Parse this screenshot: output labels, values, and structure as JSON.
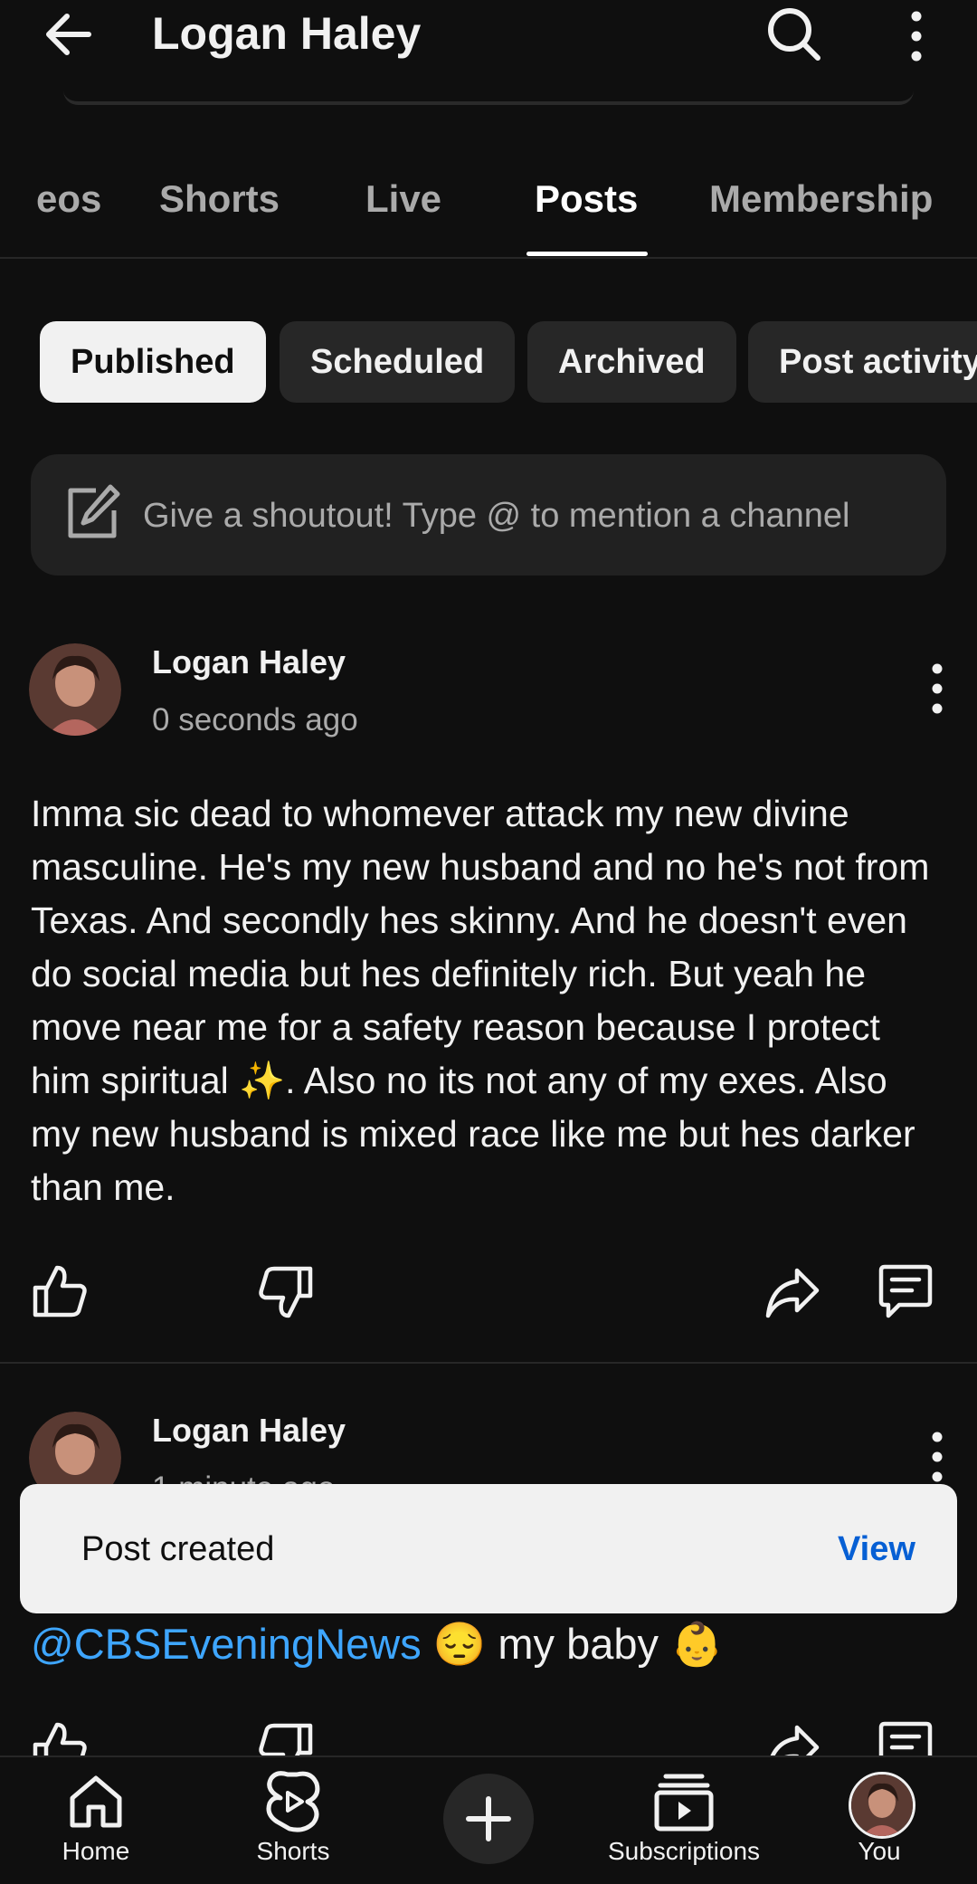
{
  "header": {
    "title": "Logan Haley",
    "icons": [
      "back-arrow-icon",
      "search-icon",
      "more-vertical-icon"
    ]
  },
  "tabs": [
    {
      "label": "eos",
      "active": false
    },
    {
      "label": "Shorts",
      "active": false
    },
    {
      "label": "Live",
      "active": false
    },
    {
      "label": "Posts",
      "active": true
    },
    {
      "label": "Membership",
      "active": false
    }
  ],
  "chips": [
    {
      "label": "Published",
      "active": true
    },
    {
      "label": "Scheduled",
      "active": false
    },
    {
      "label": "Archived",
      "active": false
    },
    {
      "label": "Post activity",
      "active": false
    }
  ],
  "compose": {
    "placeholder": "Give a shoutout! Type @ to mention a channel"
  },
  "posts": [
    {
      "author": "Logan Haley",
      "time": "0 seconds ago",
      "body": "Imma sic dead to whomever attack my new divine masculine.  He's my new husband and no he's not from Texas.  And secondly hes skinny.  And he doesn't even do social media but hes definitely rich. But yeah he move near me for a safety reason because I protect him spiritual ✨.  Also no its not any of my exes. Also my new husband is mixed race like me but hes darker than me."
    },
    {
      "author": "Logan Haley",
      "time": "1 minute ago",
      "mention": "@CBSEveningNews",
      "text": " 😔 my baby 👶"
    }
  ],
  "toast": {
    "message": "Post created",
    "action": "View"
  },
  "bottom_nav": [
    {
      "label": "Home",
      "icon": "home-icon"
    },
    {
      "label": "Shorts",
      "icon": "shorts-icon"
    },
    {
      "label": "",
      "icon": "create-plus-icon"
    },
    {
      "label": "Subscriptions",
      "icon": "subscriptions-icon"
    },
    {
      "label": "You",
      "icon": "avatar"
    }
  ],
  "colors": {
    "background": "#0f0f0f",
    "link": "#3ea6ff",
    "toast_action": "#065fd4"
  }
}
